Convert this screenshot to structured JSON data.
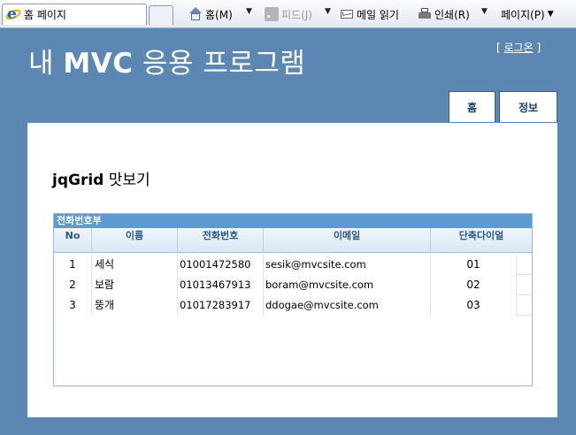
{
  "browser": {
    "tab_title": "홈 페이지",
    "commands": {
      "home": "홈(M)",
      "feeds": "피드(J)",
      "read_mail": "메일 읽기",
      "print": "인쇄(R)",
      "page": "페이지(P)"
    },
    "icons": [
      "ie-logo-icon",
      "home-icon",
      "feed-icon",
      "mail-icon",
      "printer-icon"
    ]
  },
  "header": {
    "title_prefix": "내 ",
    "title_bold": "MVC",
    "title_suffix": " 응용 프로그램",
    "login_open": "[ ",
    "login_link": "로그온",
    "login_close": " ]"
  },
  "menu": {
    "home": "홈",
    "about": "정보"
  },
  "content": {
    "heading_bold": "jqGrid",
    "heading_rest": " 맛보기"
  },
  "grid": {
    "caption": "전화번호부",
    "columns": [
      "No",
      "이름",
      "전화번호",
      "이메일",
      "단축다이얼"
    ],
    "rows": [
      {
        "no": "1",
        "name": "세식",
        "phone": "01001472580",
        "email": "sesik@mvcsite.com",
        "speed": "01"
      },
      {
        "no": "2",
        "name": "보람",
        "phone": "01013467913",
        "email": "boram@mvcsite.com",
        "speed": "02"
      },
      {
        "no": "3",
        "name": "뚱개",
        "phone": "01017283917",
        "email": "ddogae@mvcsite.com",
        "speed": "03"
      }
    ]
  },
  "colors": {
    "page_background": "#5c87b2",
    "grid_caption": "#5c9bd1",
    "grid_header_text": "#2a5a8a"
  }
}
